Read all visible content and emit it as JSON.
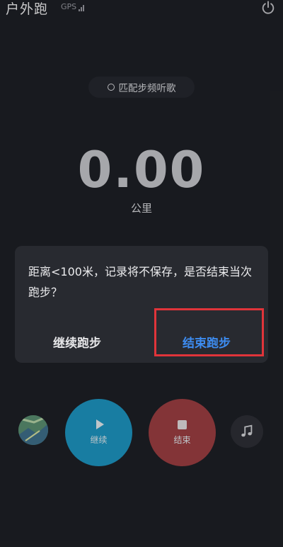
{
  "header": {
    "title": "户外跑",
    "gps_label": "GPS",
    "power_icon": "power-icon"
  },
  "pill": {
    "label": "匹配步频听歌",
    "icon": "circle-outline-icon"
  },
  "stats": {
    "distance": "0.00",
    "unit": "公里"
  },
  "dialog": {
    "message": "距离<100米，记录将不保存，是否结束当次跑步？",
    "continue_label": "继续跑步",
    "end_label": "结束跑步"
  },
  "controls": {
    "resume_label": "继续",
    "stop_label": "结束",
    "map_icon": "map-icon",
    "music_icon": "music-note-icon"
  },
  "colors": {
    "background": "#1c1e23",
    "dialog": "#282a30",
    "accent_blue": "#3d8cf0",
    "resume_button": "#1b97c2",
    "stop_button": "#9e3e40",
    "highlight": "#e0343a"
  }
}
